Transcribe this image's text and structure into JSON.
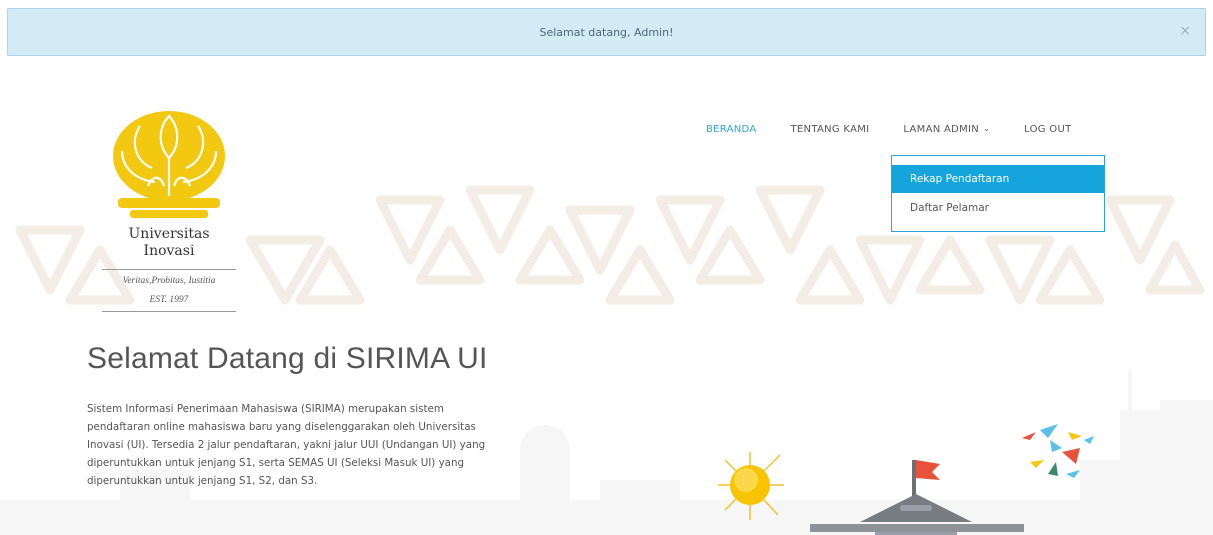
{
  "alert": {
    "message": "Selamat datang, Admin!",
    "close_symbol": "×"
  },
  "nav": {
    "items": [
      {
        "label": "BERANDA",
        "active": true
      },
      {
        "label": "TENTANG KAMI",
        "active": false
      },
      {
        "label": "LAMAN ADMIN",
        "active": false,
        "has_dropdown": true
      },
      {
        "label": "LOG OUT",
        "active": false
      }
    ],
    "dropdown": {
      "items": [
        {
          "label": "Rekap Pendaftaran",
          "selected": true
        },
        {
          "label": "Daftar Pelamar",
          "selected": false
        }
      ]
    }
  },
  "logo": {
    "name": "Universitas Inovasi",
    "name_line1": "Universitas",
    "name_line2": "Inovasi",
    "motto": "Veritas,Probitas, Iustitia",
    "est": "EST. 1997"
  },
  "hero": {
    "title": "Selamat Datang di SIRIMA UI",
    "description": "Sistem Informasi Penerimaan Mahasiswa (SIRIMA) merupakan sistem pendaftaran online mahasiswa baru yang diselenggarakan oleh Universitas Inovasi (UI). Tersedia 2 jalur pendaftaran, yakni jalur UUI (Undangan UI) yang diperuntukkan untuk jenjang S1, serta SEMAS UI (Seleksi Masuk UI) yang diperuntukkan untuk jenjang S1, S2, dan S3."
  },
  "colors": {
    "accent": "#15a5dc",
    "alert_bg": "#d2ebf5",
    "logo_gold": "#f2c811",
    "flag": "#e8523a"
  }
}
